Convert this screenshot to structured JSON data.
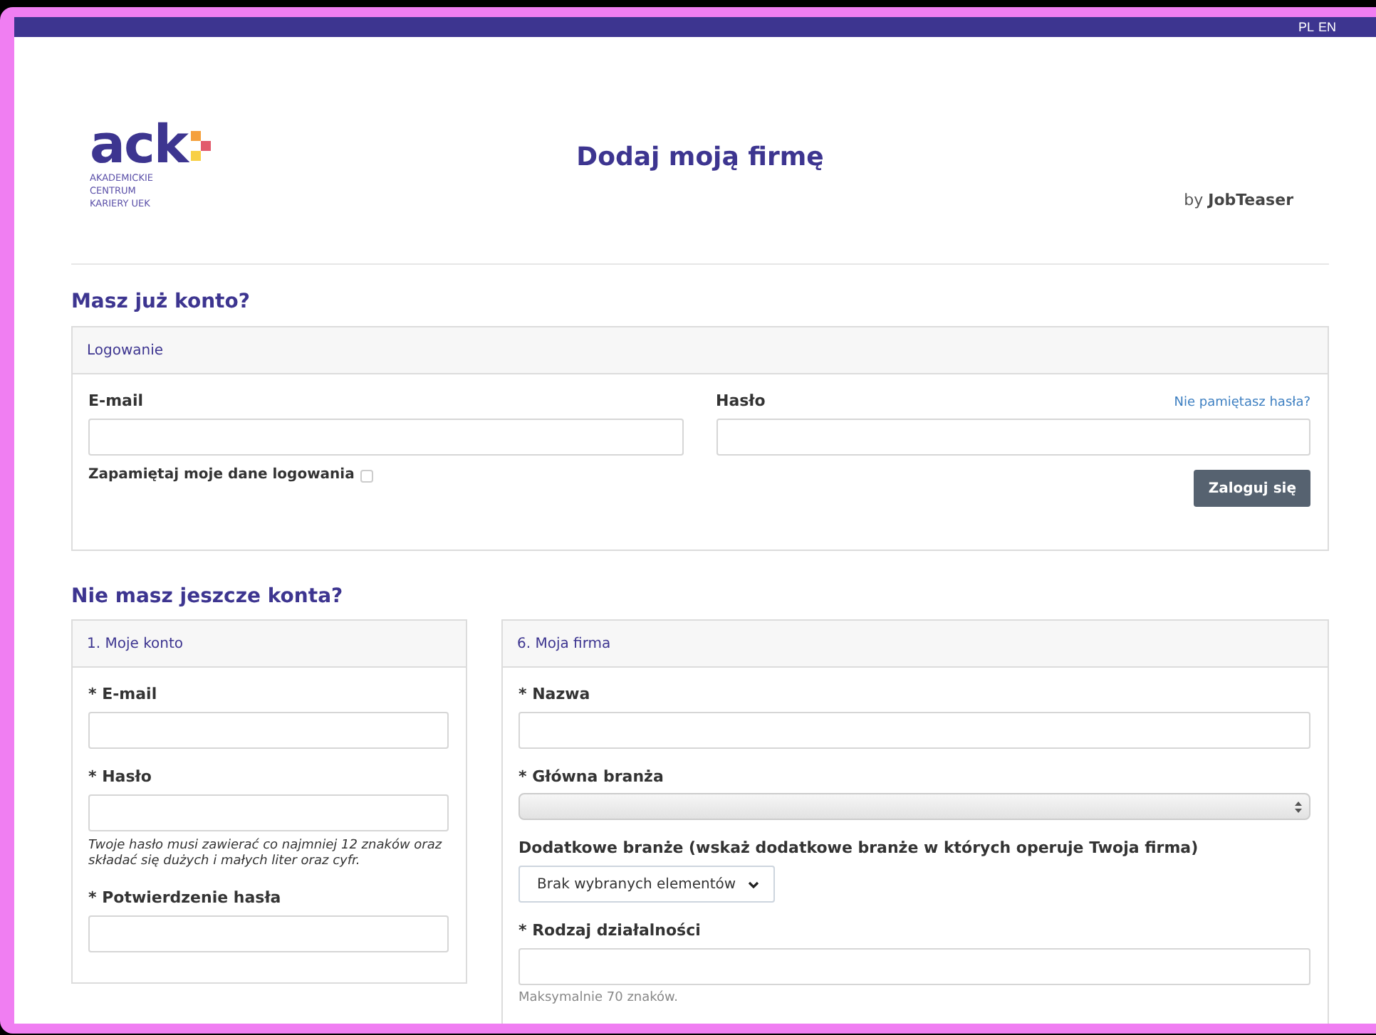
{
  "top_bar": {
    "languages": [
      "PL",
      "EN"
    ]
  },
  "header": {
    "logo": {
      "wordmark": "ack",
      "subtitle": [
        "AKADEMICKIE",
        "CENTRUM",
        "KARIERY UEK"
      ]
    },
    "title": "Dodaj moją firmę",
    "byline": {
      "prefix": "by",
      "brand": "JobTeaser"
    }
  },
  "login_section": {
    "heading": "Masz już konto?",
    "panel_title": "Logowanie",
    "email_label": "E-mail",
    "password_label": "Hasło",
    "forgot_link": "Nie pamiętasz hasła?",
    "remember": {
      "label": "Zapamiętaj moje dane logowania",
      "checked": false
    },
    "submit": "Zaloguj się"
  },
  "signup_section": {
    "heading": "Nie masz jeszcze konta?",
    "panels": [
      {
        "title": "1. Moje konto",
        "fields": [
          {
            "kind": "text",
            "label": "* E-mail"
          },
          {
            "kind": "text",
            "label": "* Hasło",
            "hint": "Twoje hasło musi zawierać co najmniej 12 znaków oraz składać się dużych i małych liter oraz cyfr."
          },
          {
            "kind": "text",
            "label": "* Potwierdzenie hasła"
          }
        ]
      },
      {
        "title": "6. Moja firma",
        "fields": [
          {
            "kind": "text",
            "label": "* Nazwa"
          },
          {
            "kind": "select",
            "label": "* Główna branża"
          },
          {
            "kind": "multiselect",
            "label": "Dodatkowe branże (wskaż dodatkowe branże w których operuje Twoja firma)",
            "button": "Brak wybranych elementów"
          },
          {
            "kind": "text",
            "label": "* Rodzaj działalności",
            "note": "Maksymalnie 70 znaków."
          }
        ]
      }
    ]
  }
}
